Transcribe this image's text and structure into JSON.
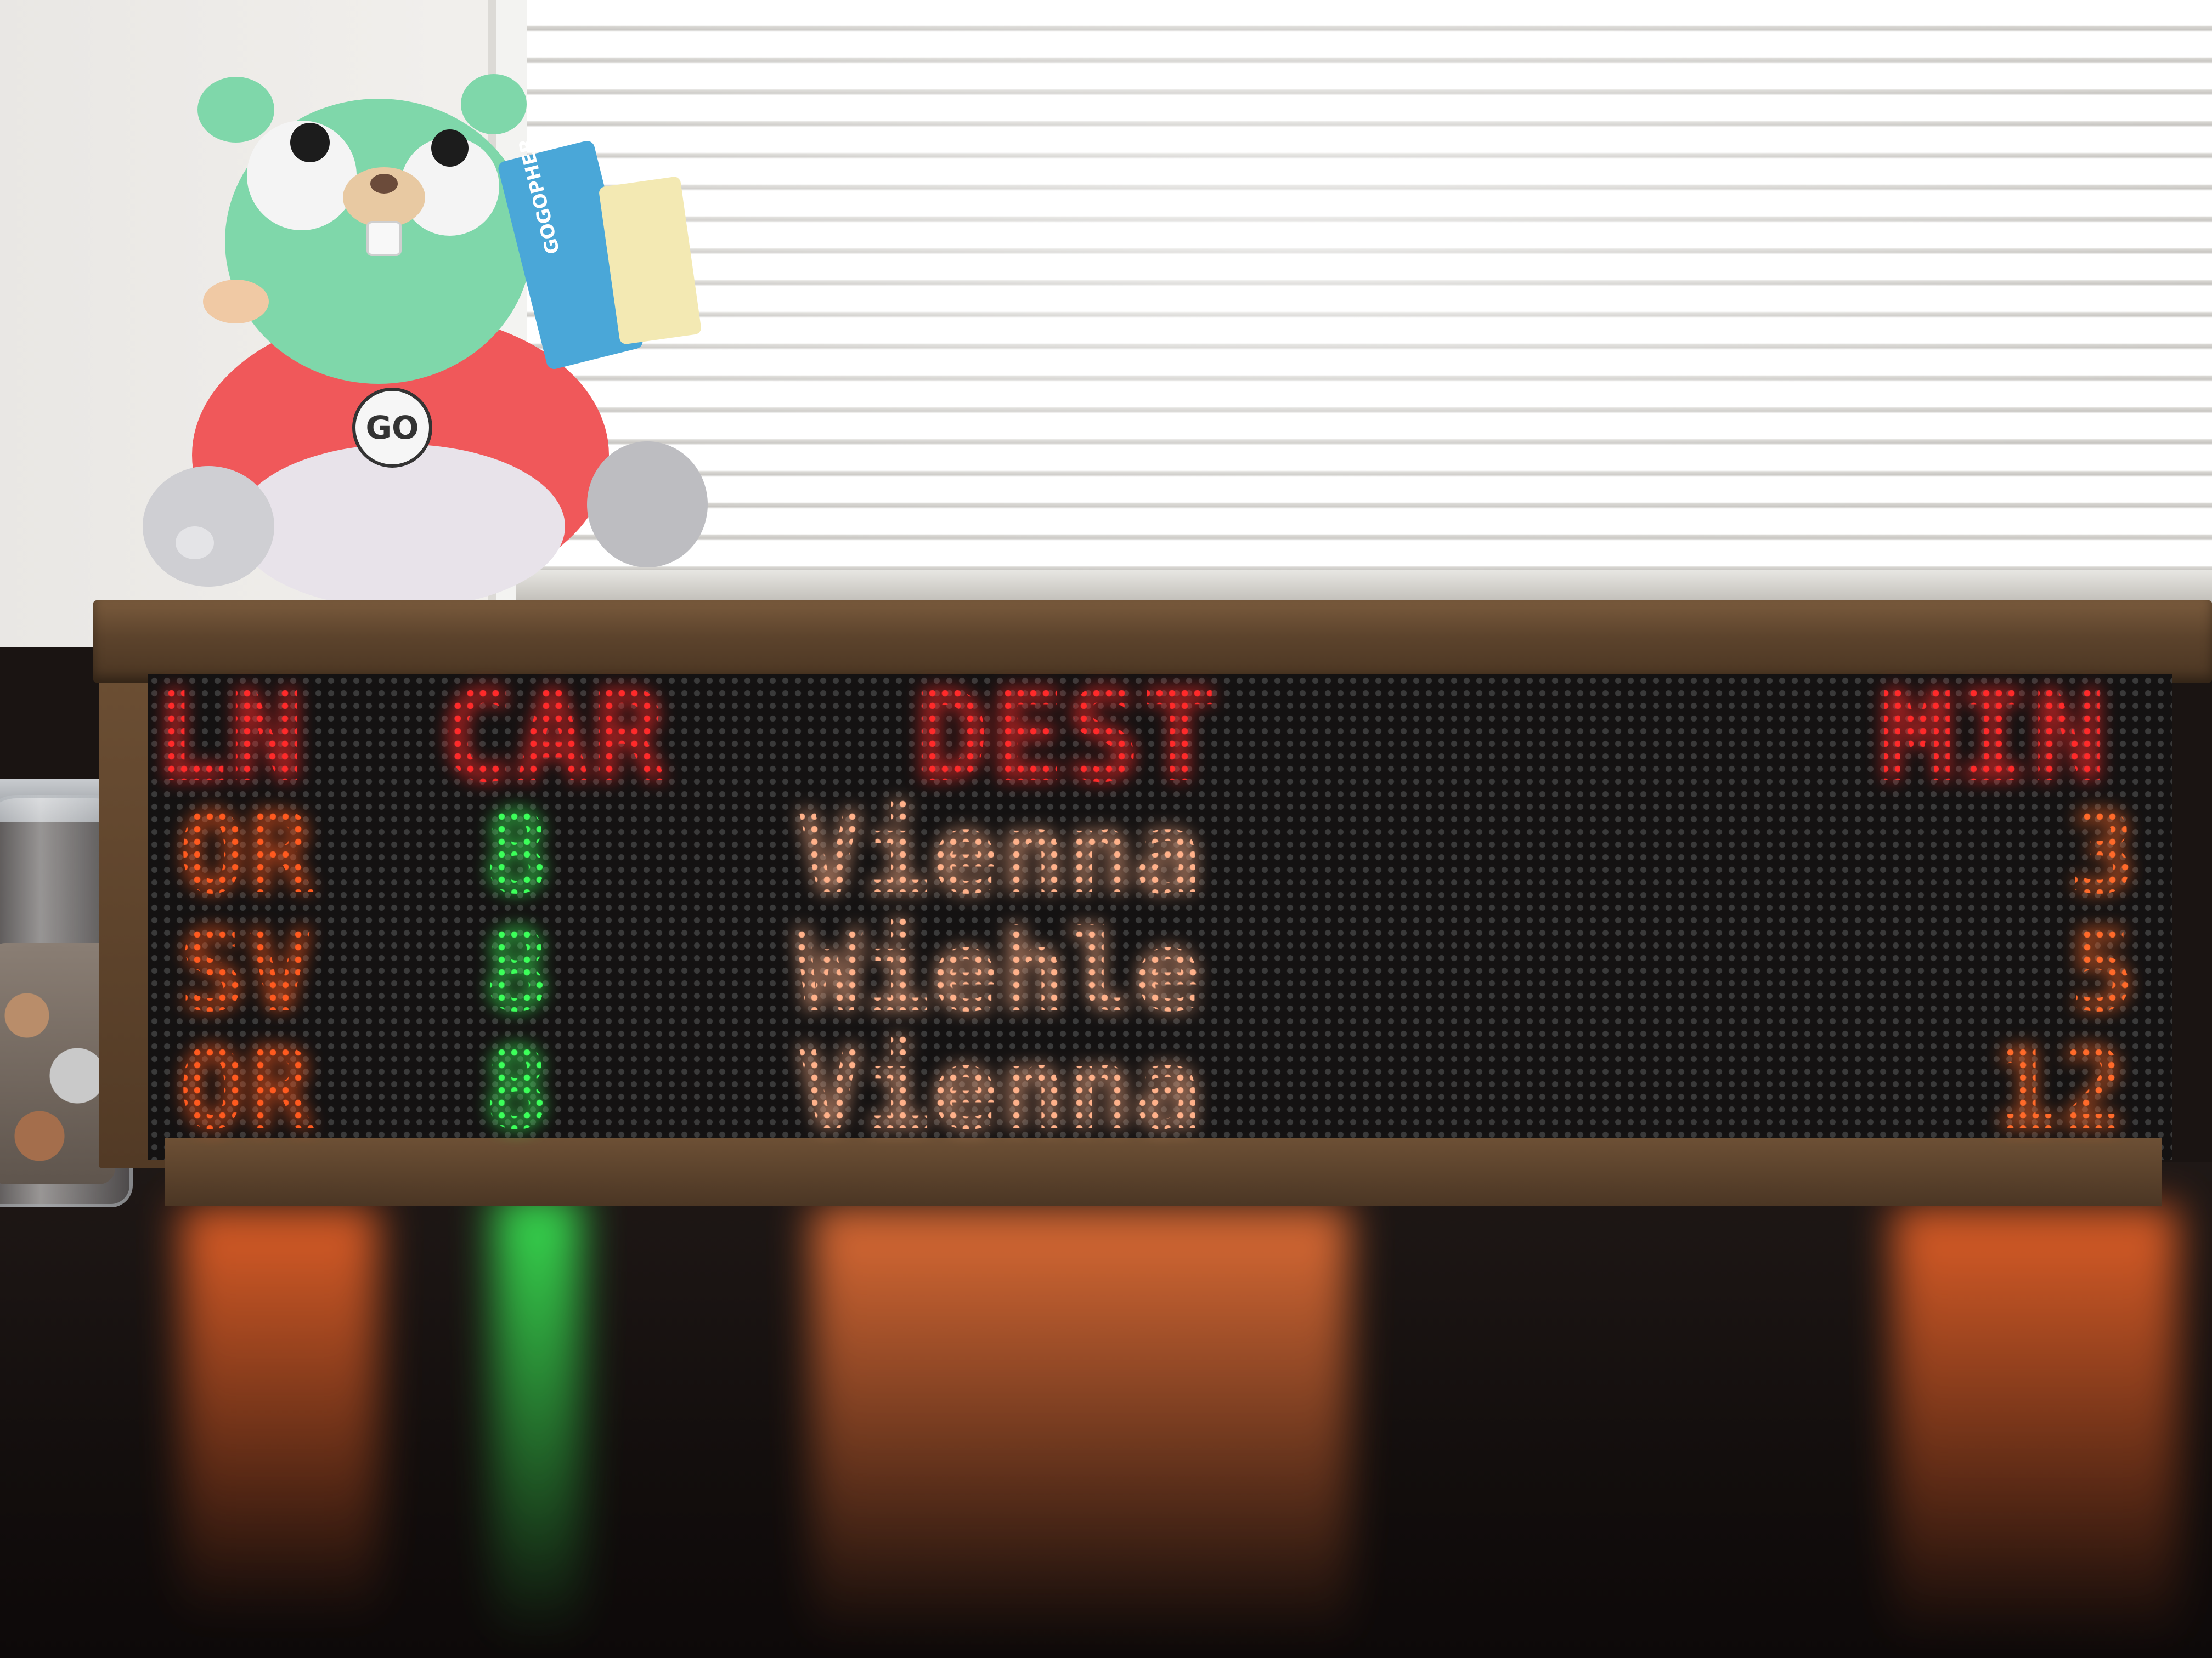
{
  "scene": {
    "colors": {
      "header": "#ff2a2a",
      "line": "#ff5a1f",
      "car": "#3cff5a",
      "dest": "#ffb18a",
      "min": "#ff6a2a",
      "wood": "#5c432c"
    }
  },
  "plush": {
    "tag_text": "GOGOPHER",
    "shirt_text": "GO"
  },
  "board": {
    "headers": {
      "line": "LN",
      "car": "CAR",
      "dest": "DEST",
      "min": "MIN"
    },
    "rows": [
      {
        "line": "OR",
        "car": "8",
        "dest": "Vienna",
        "min": "3"
      },
      {
        "line": "SV",
        "car": "8",
        "dest": "Wiehle",
        "min": "5"
      },
      {
        "line": "OR",
        "car": "8",
        "dest": "Vienna",
        "min": "12"
      }
    ]
  }
}
